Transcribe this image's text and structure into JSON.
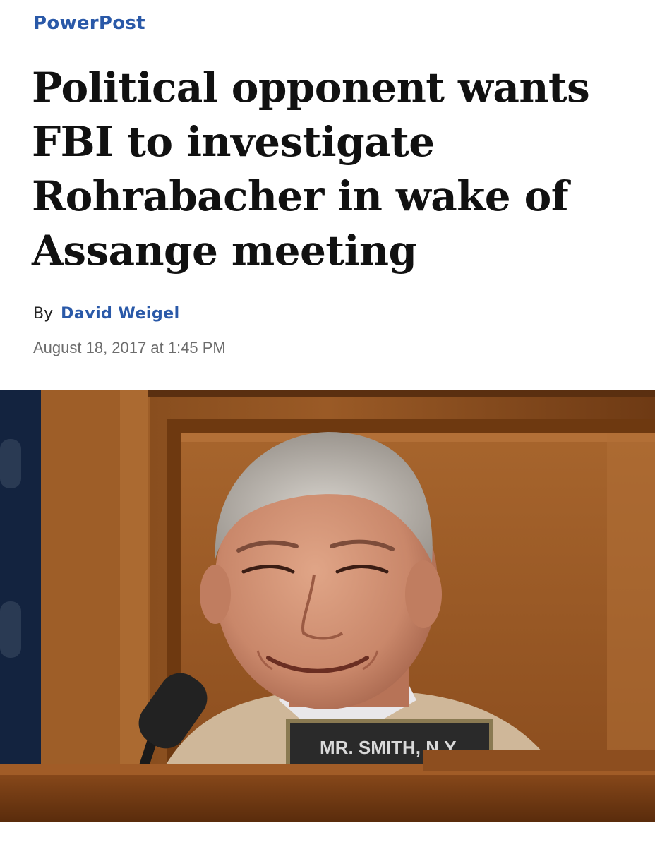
{
  "section": {
    "kicker": "PowerPost"
  },
  "article": {
    "headline": "Political opponent wants FBI to investigate Rohrabacher in wake of Assange meeting",
    "by_prefix": "By",
    "author": "David Weigel",
    "timestamp": "August 18, 2017 at 1:45 PM"
  },
  "photo": {
    "nameplate_text": "MR. SMITH, N.Y."
  },
  "colors": {
    "link_blue": "#2a59a8",
    "dateline_gray": "#6c6c6c",
    "headline": "#111111"
  }
}
